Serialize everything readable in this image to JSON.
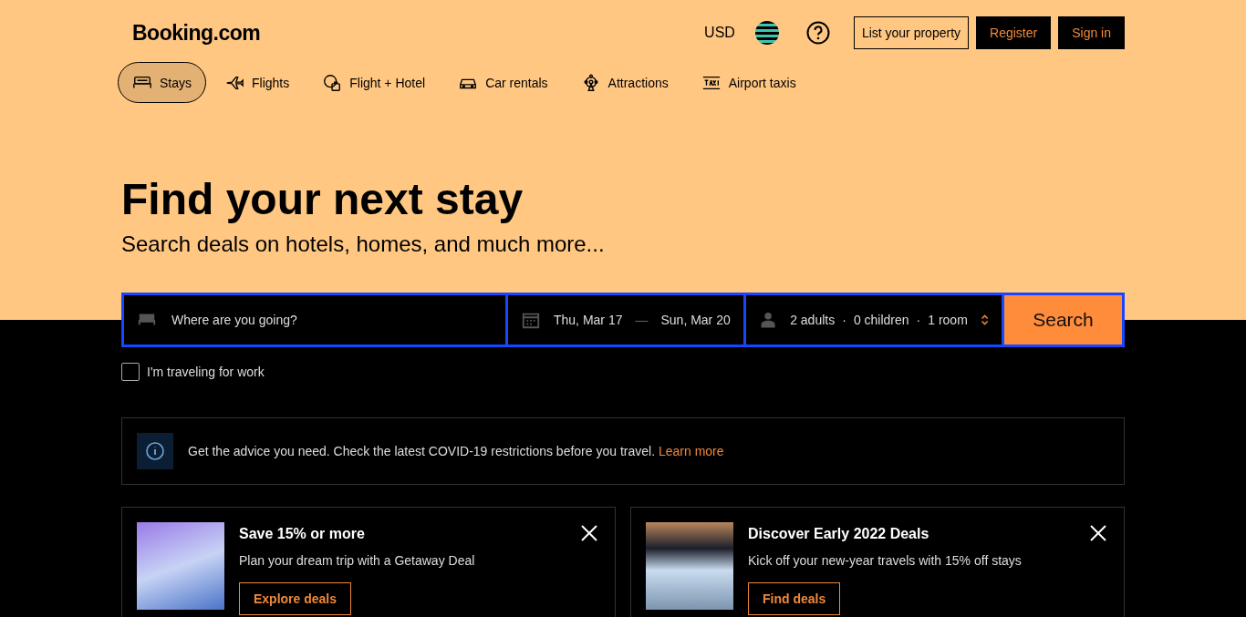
{
  "header": {
    "logo": "Booking.com",
    "currency": "USD",
    "buttons": [
      {
        "label": "List your property",
        "kind": "outline"
      },
      {
        "label": "Register",
        "kind": "dark"
      },
      {
        "label": "Sign in",
        "kind": "dark"
      }
    ]
  },
  "nav": [
    {
      "label": "Stays",
      "selected": true
    },
    {
      "label": "Flights",
      "selected": false
    },
    {
      "label": "Flight + Hotel",
      "selected": false
    },
    {
      "label": "Car rentals",
      "selected": false
    },
    {
      "label": "Attractions",
      "selected": false
    },
    {
      "label": "Airport taxis",
      "selected": false
    }
  ],
  "hero": {
    "title": "Find your next stay",
    "subtitle": "Search deals on hotels, homes, and much more..."
  },
  "search": {
    "destination": {
      "placeholder": "Where are you going?"
    },
    "check_in": "Thu, Mar 17",
    "dash": "—",
    "check_out": "Sun, Mar 20",
    "guests": [
      "2 adults",
      "0 children",
      "1 room"
    ],
    "separator": "·",
    "button": "Search"
  },
  "work_travel": {
    "label": "I'm traveling for work",
    "checked": false
  },
  "notice": {
    "text": "Get the advice you need. Check the latest COVID-19 restrictions before you travel.",
    "link": "Learn more"
  },
  "promos": [
    {
      "title": "Save 15% or more",
      "text": "Plan your dream trip with a Getaway Deal",
      "button": "Explore deals"
    },
    {
      "title": "Discover Early 2022 Deals",
      "text": "Kick off your new-year travels with 15% off stays",
      "button": "Find deals"
    }
  ]
}
